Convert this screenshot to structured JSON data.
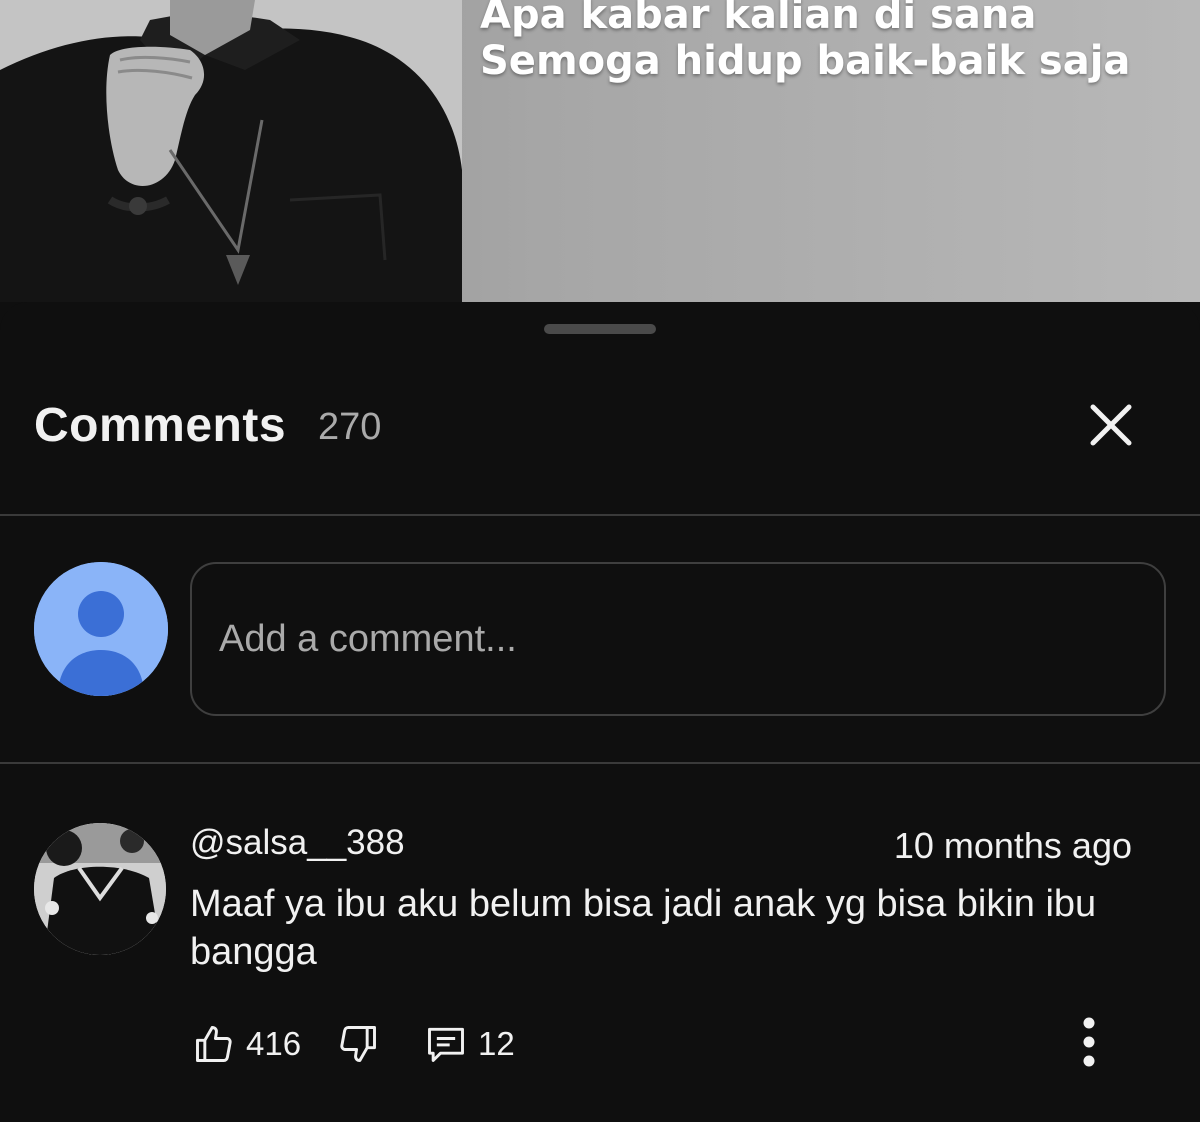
{
  "video": {
    "lyrics": [
      "Apa kabar kalian di sana",
      "Semoga hidup baik-baik saja"
    ]
  },
  "comments_panel": {
    "title": "Comments",
    "count": "270",
    "input_placeholder": "Add a comment...",
    "items": [
      {
        "author": "@salsa__388",
        "time": "10 months ago",
        "text": "Maaf ya ibu aku belum bisa jadi anak yg bisa bikin ibu bangga",
        "likes": "416",
        "replies": "12"
      }
    ]
  },
  "icons": {
    "close": "close-icon",
    "like": "thumbs-up-icon",
    "dislike": "thumbs-down-icon",
    "reply": "reply-comment-icon",
    "more": "more-vertical-icon"
  },
  "colors": {
    "background": "#0f0f0f",
    "divider": "#3a3a3a",
    "secondary_text": "#aaaaaa",
    "default_avatar_bg": "#8ab4f8",
    "default_avatar_fg": "#3b6fd6"
  }
}
